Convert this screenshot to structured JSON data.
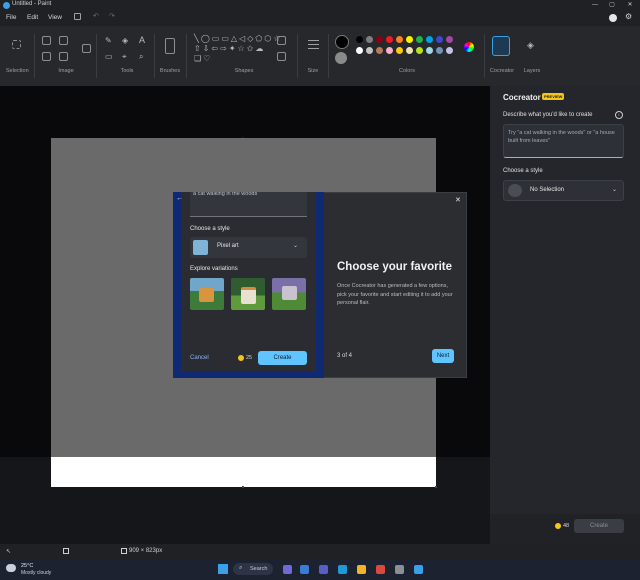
{
  "window": {
    "title": "Untitled - Paint",
    "min": "—",
    "max": "▢",
    "close": "✕"
  },
  "menu": {
    "file": "File",
    "edit": "Edit",
    "view": "View"
  },
  "ribbon": {
    "groups": [
      "Selection",
      "Image",
      "Tools",
      "Brushes",
      "Shapes",
      "Size",
      "Colors",
      "Cocreator",
      "Layers"
    ]
  },
  "palette": [
    "#000000",
    "#7f7f7f",
    "#880015",
    "#ed1c24",
    "#ff7f27",
    "#fff200",
    "#22b14c",
    "#00a2e8",
    "#3f48cc",
    "#a349a4",
    "#ffffff",
    "#c3c3c3",
    "#b97a57",
    "#ffaec9",
    "#ffc90e",
    "#efe4b0",
    "#b5e61d",
    "#99d9ea",
    "#7092be",
    "#c8bfe7"
  ],
  "panel": {
    "title": "Cocreator",
    "badge": "PREVIEW",
    "describe_label": "Describe what you'd like to create",
    "prompt_placeholder": "Try \"a cat walking in the woods\" or \"a house built from leaves\"",
    "style_label": "Choose a style",
    "style_value": "No Selection",
    "credits": "48",
    "create": "Create"
  },
  "dialog": {
    "prompt_text": "a cat walking in the woods",
    "style_label": "Choose a style",
    "style_value": "Pixel art",
    "variations_label": "Explore variations",
    "cancel": "Cancel",
    "credits": "25",
    "create": "Create",
    "heading": "Choose your favorite",
    "description": "Once Cocreator has generated a few options, pick your favorite and start editing it to add your personal flair.",
    "step": "3 of 4",
    "next": "Next"
  },
  "status": {
    "canvas_size": "909 × 823px"
  },
  "taskbar": {
    "temp": "25°C",
    "weather": "Mostly cloudy",
    "search": "Search"
  },
  "icons": [
    "back-arrow-icon",
    "close-icon",
    "info-icon",
    "chevron-down-icon",
    "coin-icon",
    "search-icon",
    "windows-start-icon",
    "weather-icon",
    "paint-app-icon"
  ]
}
